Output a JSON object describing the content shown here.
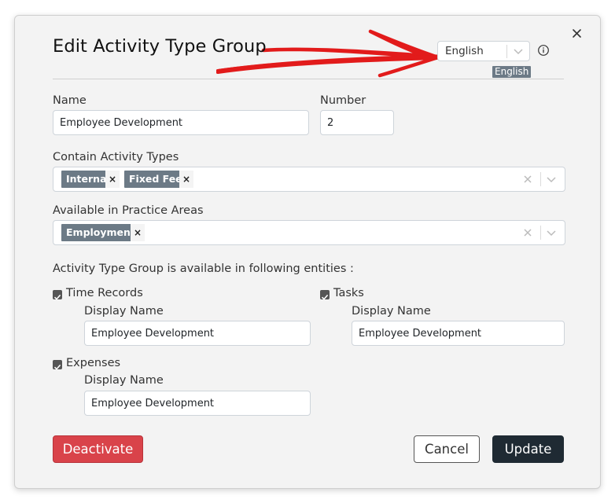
{
  "dialog": {
    "title": "Edit Activity Type Group",
    "language": {
      "selected": "English",
      "badge": "English"
    }
  },
  "form": {
    "name": {
      "label": "Name",
      "value": "Employee Development"
    },
    "number": {
      "label": "Number",
      "value": "2"
    },
    "activity_types": {
      "label": "Contain Activity Types",
      "tags": [
        "Internal",
        "Fixed Fee"
      ]
    },
    "practice_areas": {
      "label": "Available in Practice Areas",
      "tags": [
        "Employment"
      ]
    },
    "entities_heading": "Activity Type Group is available in following entities :",
    "entities": {
      "time_records": {
        "label": "Time Records",
        "checked": true,
        "display_label": "Display Name",
        "display_value": "Employee Development"
      },
      "tasks": {
        "label": "Tasks",
        "checked": true,
        "display_label": "Display Name",
        "display_value": "Employee Development"
      },
      "expenses": {
        "label": "Expenses",
        "checked": true,
        "display_label": "Display Name",
        "display_value": "Employee Development"
      }
    }
  },
  "buttons": {
    "deactivate": "Deactivate",
    "cancel": "Cancel",
    "update": "Update"
  },
  "icons": {
    "close": "close-icon",
    "info": "info-icon",
    "chevron": "chevron-down-icon",
    "clear": "clear-icon",
    "check": "check-icon",
    "annotation": "red-arrow-annotation"
  },
  "colors": {
    "tag_bg": "#6c7a86",
    "danger": "#d9434a",
    "primary": "#1f2a33",
    "annotation": "#e21b1b"
  }
}
